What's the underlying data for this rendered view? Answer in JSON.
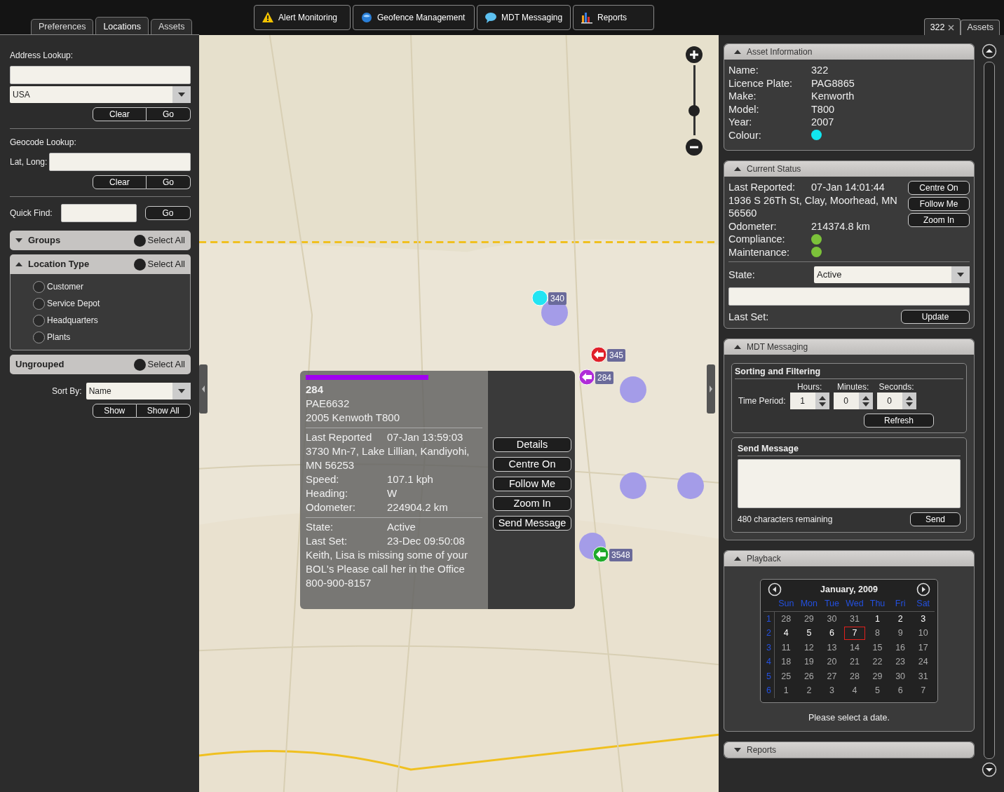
{
  "left_tabs": [
    {
      "label": "Preferences",
      "selected": false
    },
    {
      "label": "Locations",
      "selected": true
    },
    {
      "label": "Assets",
      "selected": false
    }
  ],
  "toolbar": [
    {
      "label": "Alert Monitoring",
      "kind": "warning"
    },
    {
      "label": "Geofence Management",
      "kind": "globe"
    },
    {
      "label": "MDT Messaging",
      "kind": "chat"
    },
    {
      "label": "Reports",
      "kind": "chart"
    }
  ],
  "right_tabs": [
    {
      "label": "322",
      "closable": true,
      "selected": true
    },
    {
      "label": "Assets",
      "closable": false,
      "selected": false
    }
  ],
  "locations": {
    "address_label": "Address Lookup:",
    "country": "USA",
    "address_buttons": [
      "Clear",
      "Go"
    ],
    "geocode_label": "Geocode Lookup:",
    "latlong_label": "Lat, Long:",
    "geocode_buttons": [
      "Clear",
      "Go"
    ],
    "quick_find_label": "Quick Find:",
    "quick_find_button": "Go",
    "groups": [
      {
        "title": "Groups",
        "kind": "collapsible",
        "expanded": false,
        "select_all": "Select All"
      },
      {
        "title": "Location Type",
        "kind": "collapsible",
        "expanded": true,
        "select_all": "Select All",
        "items": [
          {
            "label": "Customer",
            "checked": false
          },
          {
            "label": "Service Depot",
            "checked": false
          },
          {
            "label": "Headquarters",
            "checked": false
          },
          {
            "label": "Plants",
            "checked": false
          }
        ]
      },
      {
        "title": "Ungrouped",
        "kind": "plain",
        "select_all": "Select All"
      }
    ],
    "sort_label": "Sort By:",
    "sort_value": "Name",
    "show_buttons": [
      "Show",
      "Show All"
    ]
  },
  "map": {
    "zoom": {
      "level": 0.32
    },
    "markers": [
      {
        "label": "340",
        "kind": "dot",
        "color": "#22e4f2"
      },
      {
        "label": "345",
        "kind": "arrow",
        "color": "#e0202a"
      },
      {
        "label": "284",
        "kind": "arrow",
        "color": "#b02cd8"
      },
      {
        "label": "3548",
        "kind": "arrow",
        "color": "#1faa2a"
      }
    ],
    "popup": {
      "title": "284",
      "lines": [
        "PAE6632",
        "2005 Kenwoth T800"
      ],
      "details": [
        {
          "kind": "pair",
          "label": "Last Reported",
          "value": "07-Jan 13:59:03"
        },
        {
          "kind": "text",
          "text": "3730 Mn-7, Lake Lillian, Kandiyohi, MN 56253"
        },
        {
          "kind": "pair",
          "label": "Speed:",
          "value": "107.1 kph"
        },
        {
          "kind": "pair",
          "label": "Heading:",
          "value": "W"
        },
        {
          "kind": "pair",
          "label": "Odometer:",
          "value": "224904.2 km"
        }
      ],
      "state": [
        {
          "kind": "pair",
          "label": "State:",
          "value": "Active"
        },
        {
          "kind": "pair",
          "label": "Last Set:",
          "value": "23-Dec 09:50:08"
        },
        {
          "kind": "text",
          "text": "Keith, Lisa is missing some of your BOL's Please call her in the Office 800-900-8157"
        }
      ],
      "buttons": [
        "Details",
        "Centre On",
        "Follow Me",
        "Zoom In",
        "Send Message"
      ]
    }
  },
  "asset_information": {
    "title": "Asset Information",
    "expanded": true,
    "fields": [
      {
        "kind": "pair",
        "label": "Name:",
        "value": "322"
      },
      {
        "kind": "pair",
        "label": "Licence Plate:",
        "value": "PAG8865"
      },
      {
        "kind": "pair",
        "label": "Make:",
        "value": "Kenworth"
      },
      {
        "kind": "pair",
        "label": "Model:",
        "value": "T800"
      },
      {
        "kind": "pair",
        "label": "Year:",
        "value": "2007"
      },
      {
        "kind": "dot",
        "label": "Colour:",
        "color": "#12e6f0"
      }
    ]
  },
  "current_status": {
    "title": "Current Status",
    "expanded": true,
    "fields": [
      {
        "kind": "pair",
        "label": "Last Reported:",
        "value": "07-Jan 14:01:44"
      },
      {
        "kind": "text",
        "text": "1936 S 26Th St, Clay, Moorhead, MN 56560"
      },
      {
        "kind": "pair",
        "label": "Odometer:",
        "value": "214374.8 km"
      },
      {
        "kind": "dot",
        "label": "Compliance:",
        "color": "#7cc23a"
      },
      {
        "kind": "dot",
        "label": "Maintenance:",
        "color": "#7cc23a"
      }
    ],
    "buttons": [
      "Centre On",
      "Follow Me",
      "Zoom In"
    ],
    "state_label": "State:",
    "state_value": "Active",
    "last_set_label": "Last Set:",
    "update_button": "Update"
  },
  "mdt_messaging": {
    "title": "MDT Messaging",
    "expanded": true,
    "sorting_title": "Sorting and Filtering",
    "time_label": "Time Period:",
    "spinners": [
      {
        "label": "Hours:",
        "value": "1"
      },
      {
        "label": "Minutes:",
        "value": "0"
      },
      {
        "label": "Seconds:",
        "value": "0"
      }
    ],
    "refresh_button": "Refresh",
    "send_title": "Send Message",
    "remaining": "480 characters remaining",
    "send_button": "Send"
  },
  "playback": {
    "title": "Playback",
    "expanded": true,
    "month": "January, 2009",
    "weekdays": [
      "Sun",
      "Mon",
      "Tue",
      "Wed",
      "Thu",
      "Fri",
      "Sat"
    ],
    "weeks": [
      {
        "number": "1",
        "days": [
          {
            "label": "28",
            "bright": false,
            "selected": false
          },
          {
            "label": "29",
            "bright": false,
            "selected": false
          },
          {
            "label": "30",
            "bright": false,
            "selected": false
          },
          {
            "label": "31",
            "bright": false,
            "selected": false
          },
          {
            "label": "1",
            "bright": true,
            "selected": false
          },
          {
            "label": "2",
            "bright": true,
            "selected": false
          },
          {
            "label": "3",
            "bright": true,
            "selected": false
          }
        ]
      },
      {
        "number": "2",
        "days": [
          {
            "label": "4",
            "bright": true,
            "selected": false
          },
          {
            "label": "5",
            "bright": true,
            "selected": false
          },
          {
            "label": "6",
            "bright": true,
            "selected": false
          },
          {
            "label": "7",
            "bright": true,
            "selected": true
          },
          {
            "label": "8",
            "bright": false,
            "selected": false
          },
          {
            "label": "9",
            "bright": false,
            "selected": false
          },
          {
            "label": "10",
            "bright": false,
            "selected": false
          }
        ]
      },
      {
        "number": "3",
        "days": [
          {
            "label": "11",
            "bright": false,
            "selected": false
          },
          {
            "label": "12",
            "bright": false,
            "selected": false
          },
          {
            "label": "13",
            "bright": false,
            "selected": false
          },
          {
            "label": "14",
            "bright": false,
            "selected": false
          },
          {
            "label": "15",
            "bright": false,
            "selected": false
          },
          {
            "label": "16",
            "bright": false,
            "selected": false
          },
          {
            "label": "17",
            "bright": false,
            "selected": false
          }
        ]
      },
      {
        "number": "4",
        "days": [
          {
            "label": "18",
            "bright": false,
            "selected": false
          },
          {
            "label": "19",
            "bright": false,
            "selected": false
          },
          {
            "label": "20",
            "bright": false,
            "selected": false
          },
          {
            "label": "21",
            "bright": false,
            "selected": false
          },
          {
            "label": "22",
            "bright": false,
            "selected": false
          },
          {
            "label": "23",
            "bright": false,
            "selected": false
          },
          {
            "label": "24",
            "bright": false,
            "selected": false
          }
        ]
      },
      {
        "number": "5",
        "days": [
          {
            "label": "25",
            "bright": false,
            "selected": false
          },
          {
            "label": "26",
            "bright": false,
            "selected": false
          },
          {
            "label": "27",
            "bright": false,
            "selected": false
          },
          {
            "label": "28",
            "bright": false,
            "selected": false
          },
          {
            "label": "29",
            "bright": false,
            "selected": false
          },
          {
            "label": "30",
            "bright": false,
            "selected": false
          },
          {
            "label": "31",
            "bright": false,
            "selected": false
          }
        ]
      },
      {
        "number": "6",
        "days": [
          {
            "label": "1",
            "bright": false,
            "selected": false
          },
          {
            "label": "2",
            "bright": false,
            "selected": false
          },
          {
            "label": "3",
            "bright": false,
            "selected": false
          },
          {
            "label": "4",
            "bright": false,
            "selected": false
          },
          {
            "label": "5",
            "bright": false,
            "selected": false
          },
          {
            "label": "6",
            "bright": false,
            "selected": false
          },
          {
            "label": "7",
            "bright": false,
            "selected": false
          }
        ]
      }
    ],
    "hint": "Please select a date."
  },
  "reports": {
    "title": "Reports",
    "expanded": false
  }
}
